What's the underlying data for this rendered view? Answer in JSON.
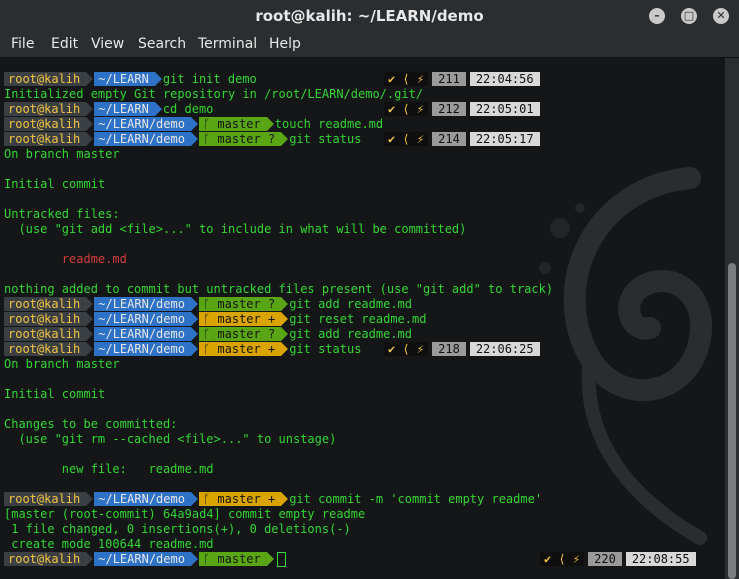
{
  "window": {
    "title": "root@kalih: ~/LEARN/demo",
    "buttons": {
      "minimize": "–",
      "maximize": "□",
      "close": "✕"
    }
  },
  "menu": [
    "File",
    "Edit",
    "View",
    "Search",
    "Terminal",
    "Help"
  ],
  "prompt": {
    "user": "root@kalih",
    "clean": "master",
    "dirty_q": "master ?",
    "dirty_plus": "master +",
    "branch_icon": "ᚴ"
  },
  "status_icons": "✔ ⟨ ⚡",
  "lines": [
    {
      "kind": "prompt",
      "dir": "~/LEARN",
      "cmd": "git init demo",
      "num": "211",
      "time": "22:04:56"
    },
    {
      "kind": "text",
      "text": "Initialized empty Git repository in /root/LEARN/demo/.git/",
      "cls": "g"
    },
    {
      "kind": "prompt",
      "dir": "~/LEARN",
      "cmd": "cd demo",
      "num": "212",
      "time": "22:05:01"
    },
    {
      "kind": "prompt",
      "dir": "~/LEARN/demo",
      "branch": "master",
      "bcls": "br-g",
      "cmd": "touch readme.md"
    },
    {
      "kind": "prompt",
      "dir": "~/LEARN/demo",
      "branch": "master ?",
      "bcls": "br-g",
      "cmd": "git status",
      "num": "214",
      "time": "22:05:17"
    },
    {
      "kind": "text",
      "text": "On branch master",
      "cls": "g"
    },
    {
      "kind": "text",
      "text": "",
      "cls": "g"
    },
    {
      "kind": "text",
      "text": "Initial commit",
      "cls": "g"
    },
    {
      "kind": "text",
      "text": "",
      "cls": "g"
    },
    {
      "kind": "text",
      "text": "Untracked files:",
      "cls": "g"
    },
    {
      "kind": "text",
      "text": "  (use \"git add <file>...\" to include in what will be committed)",
      "cls": "g"
    },
    {
      "kind": "text",
      "text": "",
      "cls": "g"
    },
    {
      "kind": "text",
      "text": "        readme.md",
      "cls": "r"
    },
    {
      "kind": "text",
      "text": "",
      "cls": "g"
    },
    {
      "kind": "text",
      "text": "nothing added to commit but untracked files present (use \"git add\" to track)",
      "cls": "g"
    },
    {
      "kind": "prompt",
      "dir": "~/LEARN/demo",
      "branch": "master ?",
      "bcls": "br-g",
      "cmd": "git add readme.md"
    },
    {
      "kind": "prompt",
      "dir": "~/LEARN/demo",
      "branch": "master +",
      "bcls": "br-y",
      "cmd": "git reset readme.md"
    },
    {
      "kind": "prompt",
      "dir": "~/LEARN/demo",
      "branch": "master ?",
      "bcls": "br-g",
      "cmd": "git add readme.md"
    },
    {
      "kind": "prompt",
      "dir": "~/LEARN/demo",
      "branch": "master +",
      "bcls": "br-y",
      "cmd": "git status",
      "num": "218",
      "time": "22:06:25"
    },
    {
      "kind": "text",
      "text": "On branch master",
      "cls": "g"
    },
    {
      "kind": "text",
      "text": "",
      "cls": "g"
    },
    {
      "kind": "text",
      "text": "Initial commit",
      "cls": "g"
    },
    {
      "kind": "text",
      "text": "",
      "cls": "g"
    },
    {
      "kind": "text",
      "text": "Changes to be committed:",
      "cls": "g"
    },
    {
      "kind": "text",
      "text": "  (use \"git rm --cached <file>...\" to unstage)",
      "cls": "g"
    },
    {
      "kind": "text",
      "text": "",
      "cls": "g"
    },
    {
      "kind": "text",
      "text": "        new file:   readme.md",
      "cls": "g"
    },
    {
      "kind": "text",
      "text": "",
      "cls": "g"
    },
    {
      "kind": "prompt",
      "dir": "~/LEARN/demo",
      "branch": "master +",
      "bcls": "br-y",
      "cmd": "git commit -m 'commit empty readme'"
    },
    {
      "kind": "text",
      "text": "[master (root-commit) 64a9ad4] commit empty readme",
      "cls": "g"
    },
    {
      "kind": "text",
      "text": " 1 file changed, 0 insertions(+), 0 deletions(-)",
      "cls": "g"
    },
    {
      "kind": "text",
      "text": " create mode 100644 readme.md",
      "cls": "g"
    },
    {
      "kind": "prompt",
      "dir": "~/LEARN/demo",
      "branch": "master",
      "bcls": "br-g",
      "cmd": "",
      "cursor": true,
      "num": "220",
      "time": "22:08:55"
    }
  ]
}
